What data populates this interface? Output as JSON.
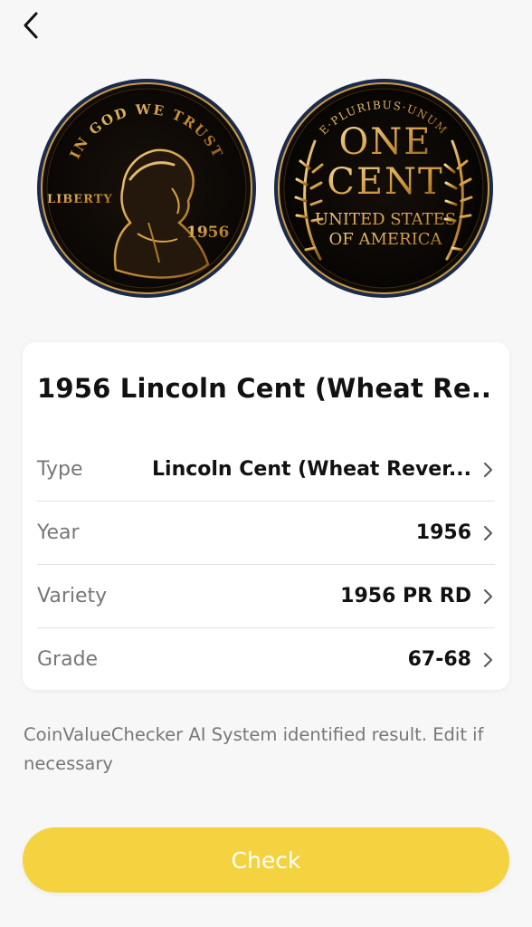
{
  "icons": {
    "back": "chevron-left-icon",
    "row_chevron": "chevron-right-icon"
  },
  "coins": {
    "obverse": {
      "motto": "IN GOD WE TRUST",
      "liberty": "LIBERTY",
      "year": "1956"
    },
    "reverse": {
      "motto": "E·PLURIBUS·UNUM",
      "denomination_1": "ONE",
      "denomination_2": "CENT",
      "country_1": "UNITED STATES",
      "country_2": "OF AMERICA"
    }
  },
  "card": {
    "title": "1956 Lincoln Cent (Wheat Re...",
    "rows": [
      {
        "label": "Type",
        "value": "Lincoln Cent (Wheat Rever..."
      },
      {
        "label": "Year",
        "value": "1956"
      },
      {
        "label": "Variety",
        "value": "1956 PR RD"
      },
      {
        "label": "Grade",
        "value": "67-68"
      }
    ]
  },
  "note": "CoinValueChecker AI System identified result. Edit if necessary",
  "check_button": {
    "label": "Check"
  },
  "colors": {
    "background": "#f7f7f7",
    "accent": "#f5d23f",
    "coin_rim": "#1a2a4a",
    "coin_gold": "#d9a441"
  }
}
